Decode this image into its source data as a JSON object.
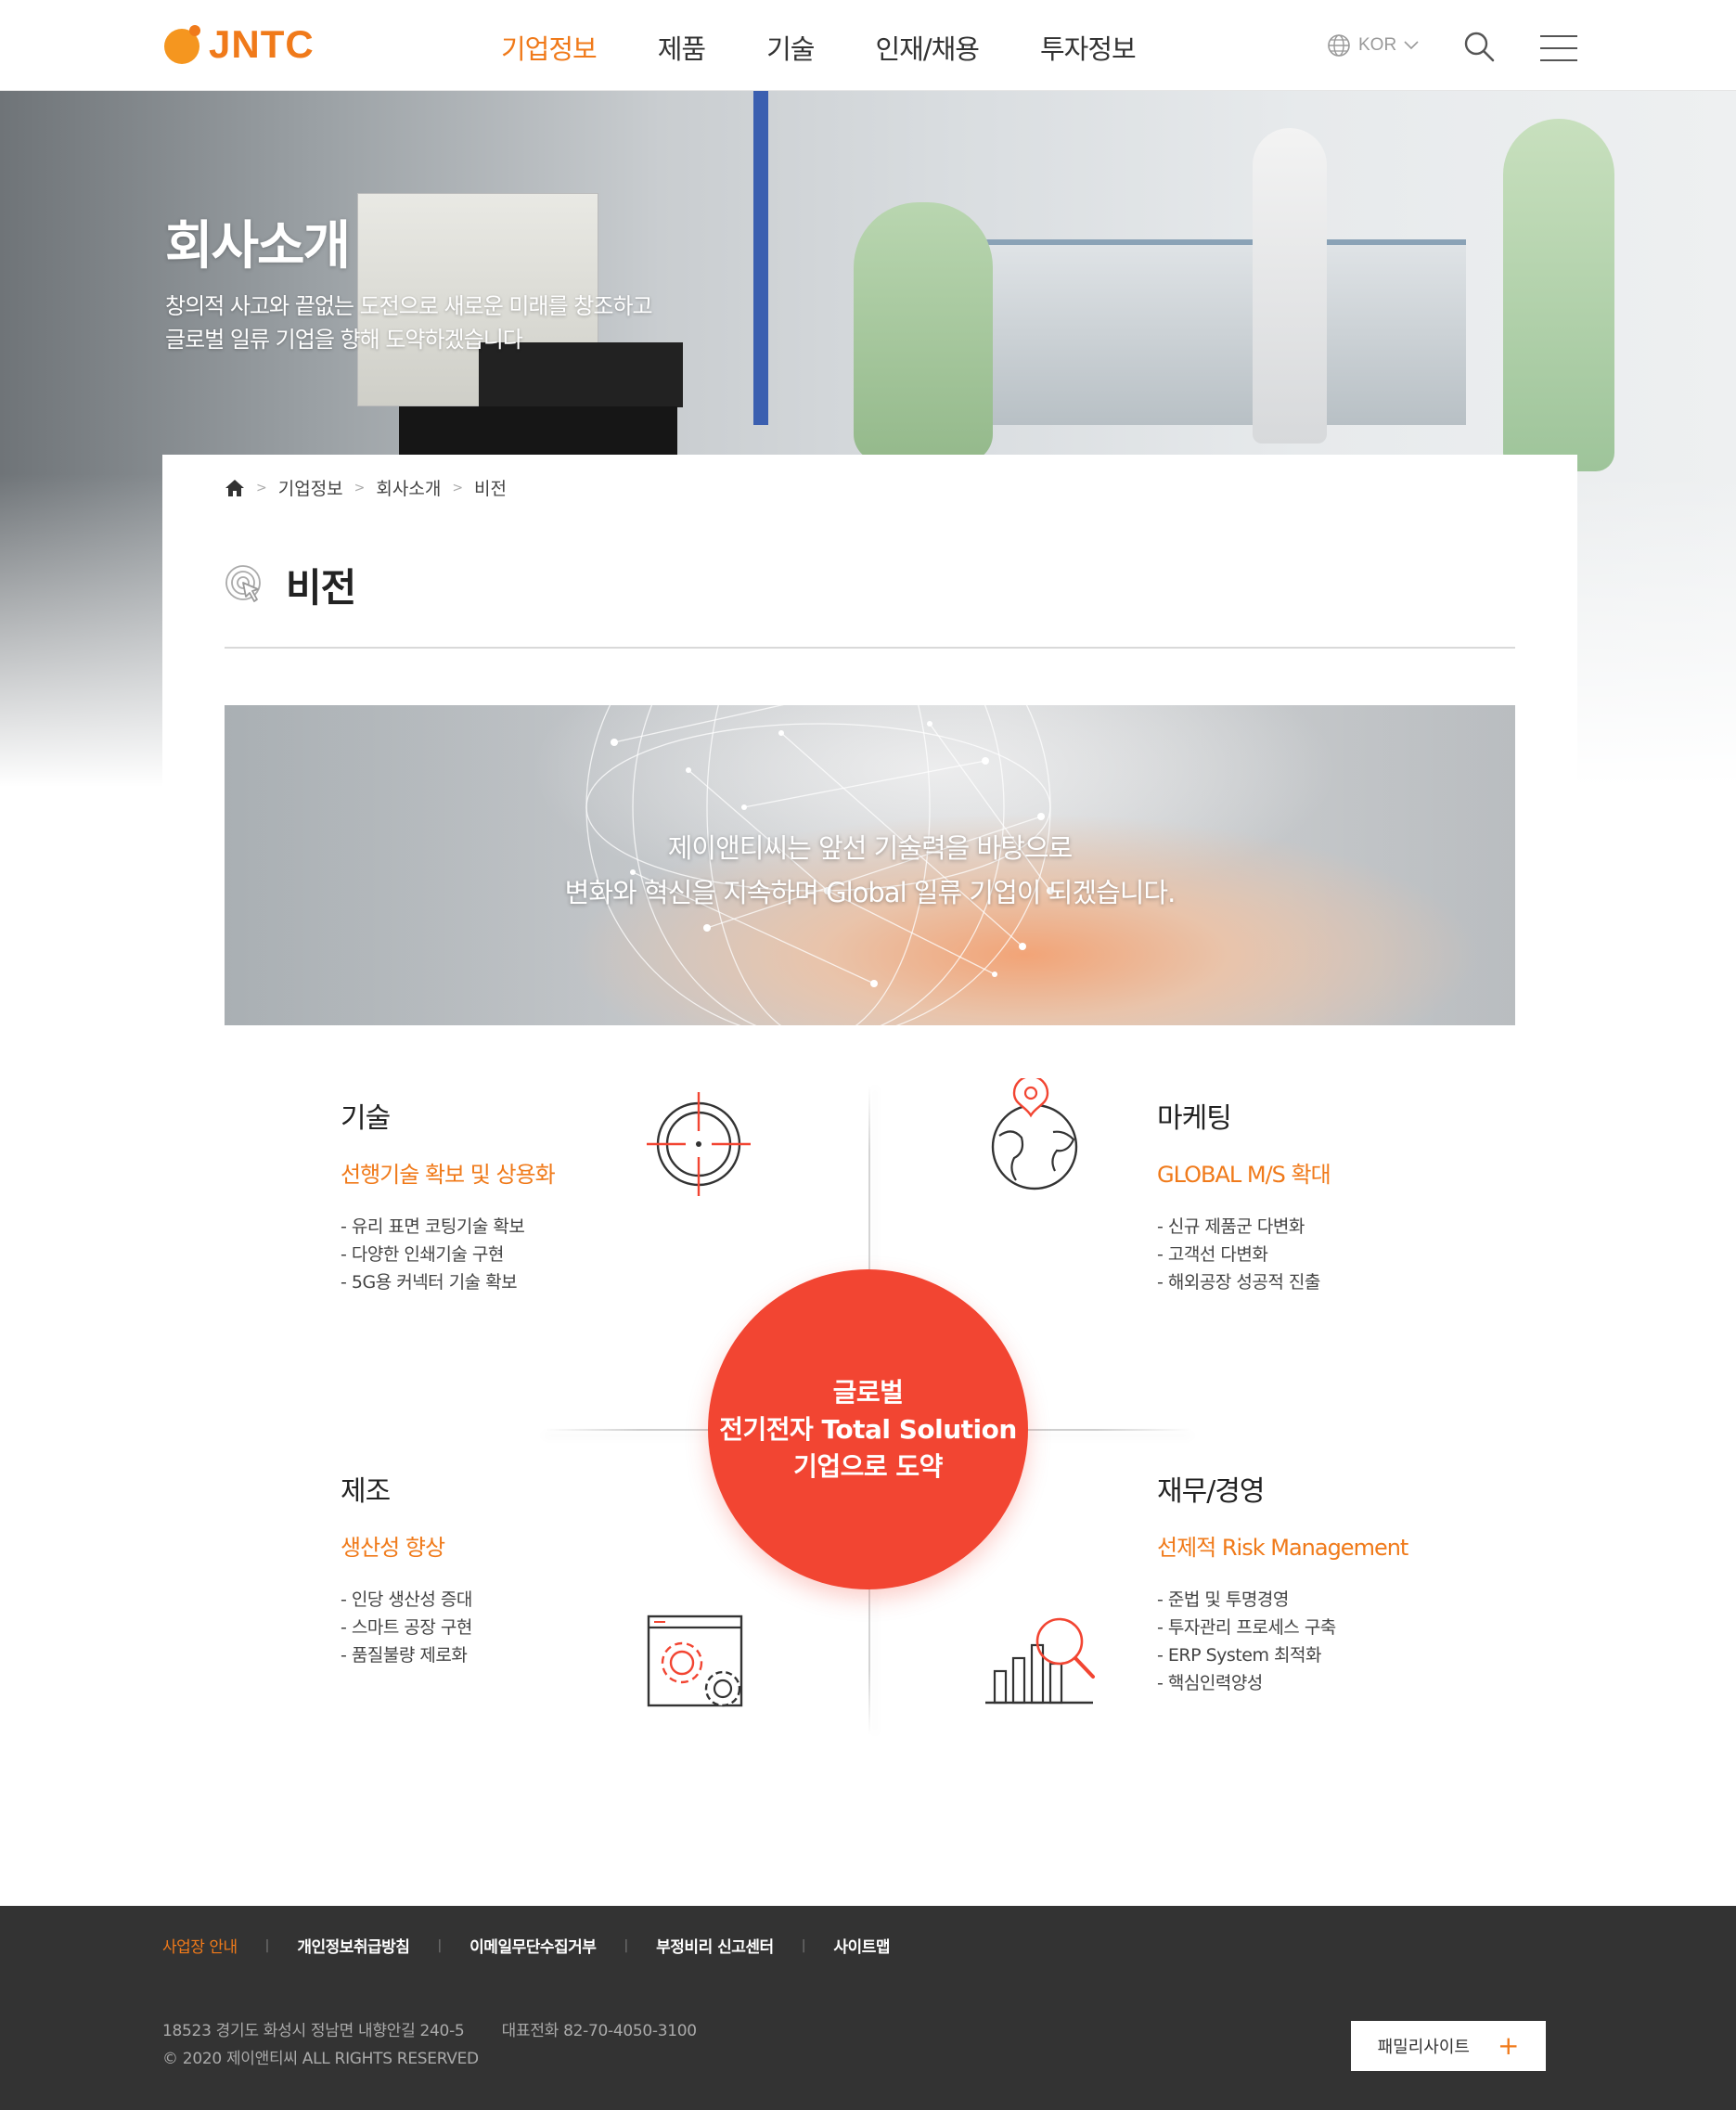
{
  "header": {
    "logo_text": "JNTC",
    "nav": [
      "기업정보",
      "제품",
      "기술",
      "인재/채용",
      "투자정보"
    ],
    "lang": "KOR",
    "icons": {
      "lang": "globe-icon",
      "search": "search-icon",
      "menu": "hamburger-menu-icon"
    },
    "accent_color": "#f07a1a"
  },
  "hero": {
    "title": "회사소개",
    "subtitle_line1": "창의적 사고와 끝없는 도전으로 새로운 미래를 창조하고",
    "subtitle_line2": "글로벌 일류 기업을 향해 도약하겠습니다"
  },
  "breadcrumb": [
    "기업정보",
    "회사소개",
    "비전"
  ],
  "page_title": "비전",
  "banner": {
    "line1": "제이앤티씨는 앞선 기술력을 바탕으로",
    "line2": "변화와 혁신을 지속하며 Global 일류 기업이 되겠습니다."
  },
  "center": {
    "line1": "글로벌",
    "line2": "전기전자 Total Solution",
    "line3": "기업으로 도약",
    "color": "#f24532"
  },
  "quadrants": {
    "tech": {
      "title": "기술",
      "subtitle": "선행기술 확보 및 상용화",
      "items": [
        "- 유리 표면 코팅기술 확보",
        "- 다양한 인쇄기술 구현",
        "- 5G용 커넥터 기술  확보"
      ],
      "icon": "target-icon"
    },
    "marketing": {
      "title": "마케팅",
      "subtitle": "GLOBAL M/S 확대",
      "items": [
        "- 신규 제품군 다변화",
        "- 고객선 다변화",
        "- 해외공장 성공적 진출"
      ],
      "icon": "globe-pin-icon"
    },
    "manufacturing": {
      "title": "제조",
      "subtitle": "생산성 향상",
      "items": [
        "- 인당 생산성 증대",
        "- 스마트  공장 구현",
        "- 품질불량 제로화"
      ],
      "icon": "gear-window-icon"
    },
    "finance": {
      "title": "재무/경영",
      "subtitle": "선제적 Risk Management",
      "items": [
        "- 준법 및 투명경영",
        "- 투자관리 프로세스 구축",
        "- ERP System 최적화",
        "- 핵심인력양성"
      ],
      "icon": "chart-magnifier-icon"
    }
  },
  "footer": {
    "links": [
      "사업장 안내",
      "개인정보취급방침",
      "이메일무단수집거부",
      "부정비리 신고센터",
      "사이트맵"
    ],
    "address": "18523 경기도 화성시 정남면 내향안길 240-5",
    "phone": "대표전화 82-70-4050-3100",
    "copyright": "© 2020 제이앤티씨 ALL RIGHTS RESERVED",
    "family_site": "패밀리사이트",
    "family_plus": "+"
  }
}
